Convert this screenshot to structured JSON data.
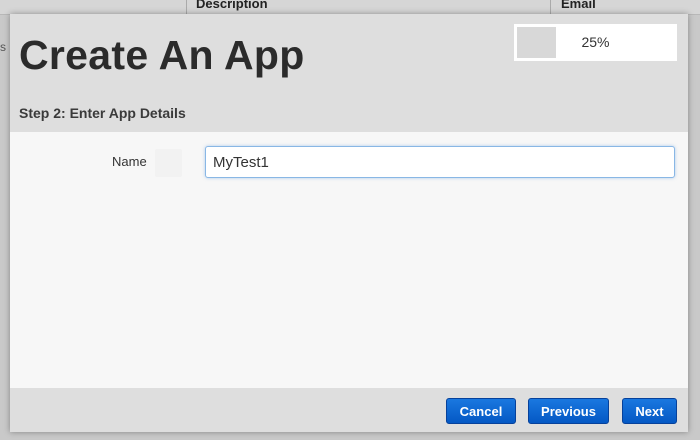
{
  "background": {
    "columns": [
      "Description",
      "Email"
    ],
    "edge_char": "s"
  },
  "modal": {
    "title": "Create An App",
    "progress": {
      "percent": 25,
      "label": "25%"
    },
    "step_title": "Step 2: Enter App Details",
    "form": {
      "name_label": "Name",
      "name_value": "MyTest1"
    },
    "buttons": {
      "cancel": "Cancel",
      "previous": "Previous",
      "next": "Next"
    }
  },
  "colors": {
    "button_primary": "#0a63d1",
    "input_focus_border": "#89b7e5",
    "modal_bg": "#dedede",
    "form_bg": "#f7f7f7"
  }
}
